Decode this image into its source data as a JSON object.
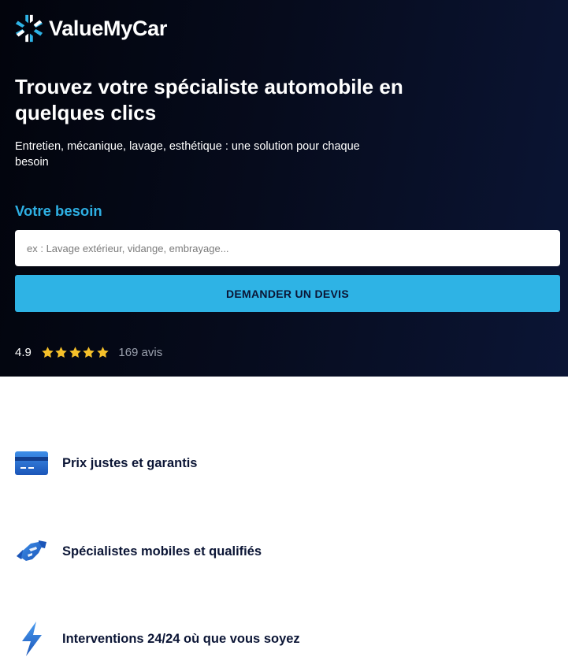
{
  "brand": {
    "name": "ValueMyCar"
  },
  "hero": {
    "title": "Trouvez votre spécialiste automobile en quelques clics",
    "subtitle": "Entretien, mécanique, lavage, esthétique : une solution pour chaque besoin"
  },
  "form": {
    "need_label": "Votre besoin",
    "need_placeholder": "ex : Lavage extérieur, vidange, embrayage...",
    "need_value": "",
    "submit_label": "DEMANDER UN DEVIS"
  },
  "rating": {
    "score": "4.9",
    "stars": 5,
    "count_text": "169 avis"
  },
  "features": [
    {
      "icon": "credit-card-icon",
      "label": "Prix justes et garantis"
    },
    {
      "icon": "handshake-icon",
      "label": "Spécialistes mobiles et qualifiés"
    },
    {
      "icon": "lightning-icon",
      "label": "Interventions 24/24 où que vous soyez"
    }
  ],
  "colors": {
    "accent": "#2eb3e5",
    "dark_navy": "#0b1535",
    "star": "#f5c02a",
    "icon_blue": "#1f6fd0"
  }
}
